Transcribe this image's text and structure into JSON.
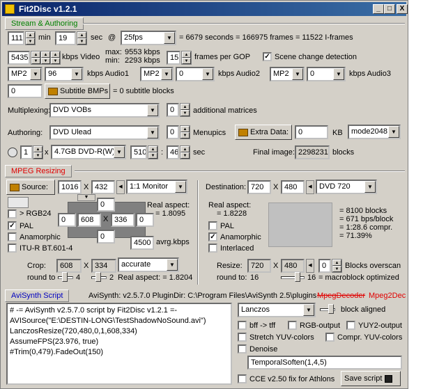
{
  "window": {
    "title": "Fit2Disc v1.2.1",
    "minimize": "_",
    "maximize": "□",
    "close": "X"
  },
  "stream": {
    "section": "Stream & Authoring",
    "minutes": "111",
    "min_label": "min",
    "seconds": "19",
    "sec_label": "sec",
    "at_label": "@",
    "fps": "25fps",
    "summary": "= 6679 seconds = 166975 frames = 11522 I-frames",
    "video_kbps": "5435",
    "video_label": "kbps Video",
    "max_label": "max:",
    "max_value": "9553 kbps",
    "min2_label": "min:",
    "min2_value": "2293 kbps",
    "gop": "15",
    "gop_label": "frames per GOP",
    "scene_change": "Scene change detection",
    "audio1_codec": "MP2",
    "audio1_kbps": "96",
    "audio1_label": "kbps Audio1",
    "audio2_codec": "MP2",
    "audio2_kbps": "0",
    "audio2_label": "kbps Audio2",
    "audio3_codec": "MP2",
    "audio3_kbps": "0",
    "audio3_label": "kbps Audio3",
    "subtitle_count": "0",
    "subtitle_button": "Subtitle BMPs",
    "subtitle_info": "= 0 subtitle blocks",
    "multiplexing_label": "Multiplexing:",
    "multiplexing": "DVD VOBs",
    "matrices": "0",
    "matrices_label": "additional matrices",
    "authoring_label": "Authoring:",
    "authoring": "DVD Ulead",
    "menupics": "0",
    "menupics_label": "Menupics",
    "extra_button": "Extra Data:",
    "extra_kb": "0",
    "kb_label": "KB",
    "mode": "mode2048",
    "disc_count": "1",
    "x_label": "x",
    "disc_type": "4.7GB DVD-R(W)",
    "disc_a": "510",
    "colon": ":",
    "disc_b": "46",
    "sec2_label": "sec",
    "final_label": "Final image:",
    "final_value": "2298231",
    "blocks_label": "blocks"
  },
  "mpeg": {
    "section": "MPEG Resizing",
    "source_button": "Source:",
    "src_w": "1016",
    "x1": "X",
    "src_h": "432",
    "monitor": "1:1 Monitor",
    "rgb24": "> RGB24",
    "pal": "PAL",
    "anamorphic": "Anamorphic",
    "itu": "ITU-R BT.601-4",
    "crop_top": "0",
    "crop_left": "0",
    "crop_w": "608",
    "crop_x": "X",
    "crop_h": "336",
    "crop_right": "0",
    "crop_bottom": "0",
    "real_aspect_label": "Real aspect:",
    "real_aspect_value": "= 1.8095",
    "bitrate": "4500",
    "bitrate_label": "avrg.kbps",
    "crop_label": "Crop:",
    "crop_out_w": "608",
    "crop_out_x": "X",
    "crop_out_h": "334",
    "crop_mode": "accurate",
    "round_label": "round to",
    "round_value": "4",
    "round2_value": "2",
    "real_aspect2": "Real aspect: = 1.8204",
    "dest_label": "Destination:",
    "dest_w": "720",
    "x2": "X",
    "dest_h": "480",
    "dest_format": "DVD 720",
    "dest_aspect_label": "Real aspect:",
    "dest_aspect_value": "= 1.8228",
    "dest_pal": "PAL",
    "dest_anamorphic": "Anamorphic",
    "dest_interlaced": "Interlaced",
    "stats": [
      "= 8100 blocks",
      "= 671 bps/block",
      "= 1:28.6 compr.",
      "= 71.39%"
    ],
    "resize_label": "Resize:",
    "resize_w": "720",
    "x3": "X",
    "resize_h": "480",
    "overscan": "0",
    "overscan_label": "Blocks overscan",
    "round3_label": "round to:",
    "round3_value": "16",
    "round4_value": "16",
    "macroblock": "= macroblock optimized"
  },
  "avisynth": {
    "tab": "AviSynth Script",
    "version_info": "AviSynth: v2.5.7.0   PluginDir: C:\\Program Files\\AviSynth 2.5\\plugins",
    "decoder1": "MpegDecoder",
    "decoder2": "Mpeg2Dec",
    "script": [
      "# -= AviSynth v2.5.7.0 script by Fit2Disc v1.2.1 =-",
      "AVISource(\"E:\\DESTIN-LONG\\TestShadowNoSound.avi\")",
      "LanczosResize(720,480,0,1,608,334)",
      "AssumeFPS(23.976, true)",
      "#Trim(0,479).FadeOut(150)"
    ],
    "resizer": "Lanczos",
    "block_aligned": "block aligned",
    "bff": "bff -> tff",
    "rgb_output": "RGB-output",
    "yuy2_output": "YUY2-output",
    "stretch_yuv": "Stretch YUV-colors",
    "compr_yuv": "Compr. YUV-colors",
    "denoise": "Denoise",
    "denoise_filter": "TemporalSoften(1,4,5)",
    "cce_fix": "CCE v2.50 fix for Athlons",
    "save_button": "Save script"
  }
}
